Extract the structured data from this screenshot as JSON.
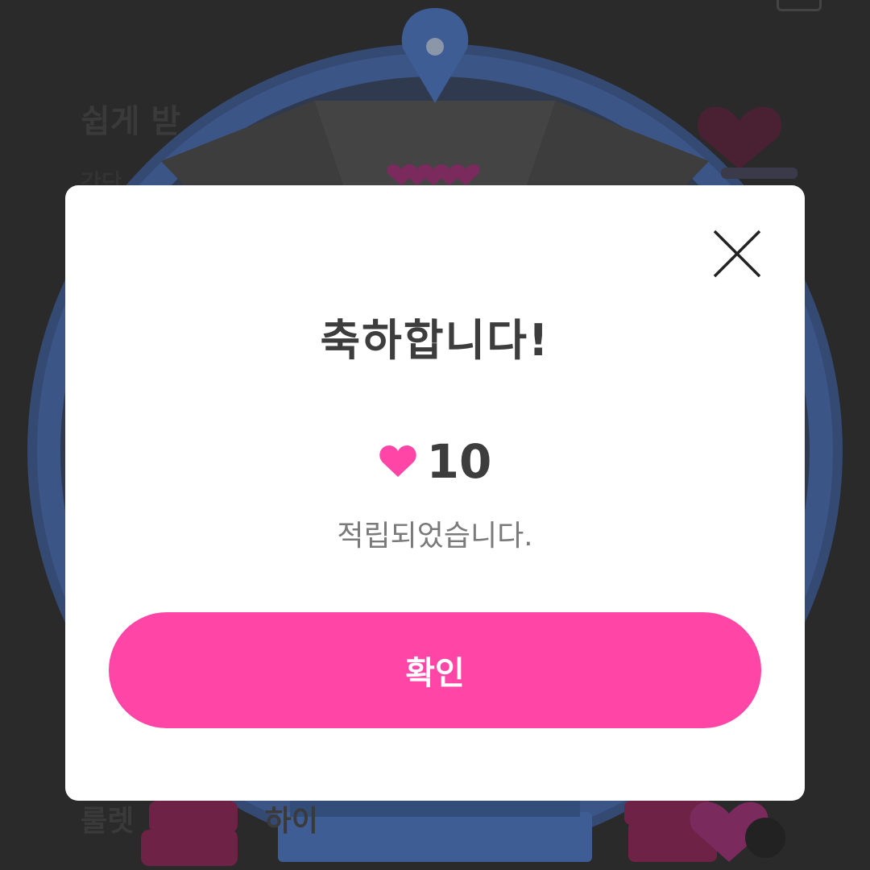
{
  "background": {
    "title_partial": "쉽게 받",
    "subtitle_partial": "간단",
    "bottom_partial": "룰렛",
    "bottom_partial_2": "하이",
    "wheel_pointer_color": "#3e5d94",
    "wheel_rim_color": "#4a6aa8"
  },
  "modal": {
    "close_icon": "close-icon",
    "title": "축하합니다!",
    "reward_icon": "heart-icon",
    "reward_icon_color": "#ff45a6",
    "reward_amount": "10",
    "message": "적립되었습니다.",
    "confirm_label": "확인",
    "confirm_color": "#ff45a6"
  }
}
